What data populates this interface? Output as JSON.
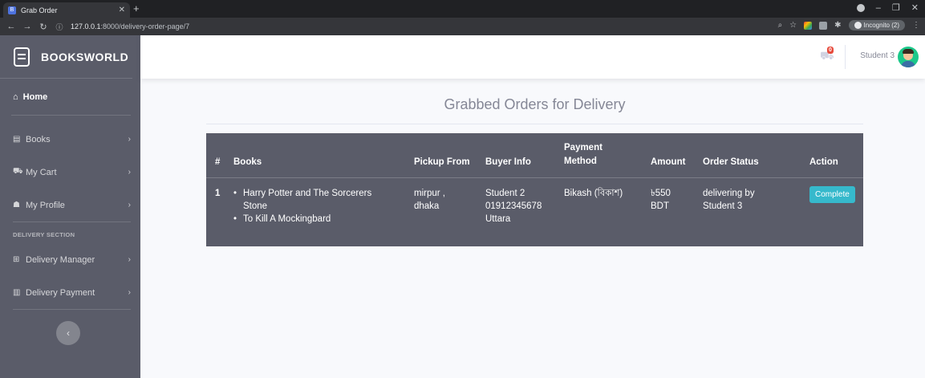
{
  "browser": {
    "tab_title": "Grab Order",
    "tab_favicon": "B",
    "url_host": "127.0.0.1",
    "url_rest": ":8000/delivery-order-page/7",
    "incognito_label": "Incognito (2)"
  },
  "sidebar": {
    "brand": "BOOKSWORLD",
    "home": "Home",
    "items": [
      {
        "label": "Books",
        "icon": "book-icon"
      },
      {
        "label": "My Cart",
        "icon": "cart-icon"
      },
      {
        "label": "My Profile",
        "icon": "user-icon"
      }
    ],
    "section_heading": "DELIVERY SECTION",
    "delivery_items": [
      {
        "label": "Delivery Manager",
        "icon": "table-icon"
      },
      {
        "label": "Delivery Payment",
        "icon": "chart-icon"
      }
    ]
  },
  "topbar": {
    "cart_count": "0",
    "username": "Student 3"
  },
  "main": {
    "title": "Grabbed Orders for Delivery",
    "columns": {
      "index": "#",
      "books": "Books",
      "pickup": "Pickup From",
      "buyer": "Buyer Info",
      "payment_line1": "Payment",
      "payment_line2": "Method",
      "amount": "Amount",
      "status": "Order Status",
      "action": "Action"
    },
    "rows": [
      {
        "index": "1",
        "books": [
          "Harry Potter and The Sorcerers",
          "Stone",
          "To Kill A Mockingbard"
        ],
        "pickup": [
          "mirpur ,",
          "dhaka"
        ],
        "buyer": [
          "Student 2",
          "01912345678",
          "Uttara"
        ],
        "payment": "Bikash (বিকাশ)",
        "amount": [
          "৳550",
          "BDT"
        ],
        "status": [
          "delivering by",
          "Student 3"
        ],
        "action": "Complete"
      }
    ]
  },
  "colors": {
    "sidebar": "#5a5c69",
    "accent": "#36b9cc",
    "badge": "#e74a3b"
  }
}
